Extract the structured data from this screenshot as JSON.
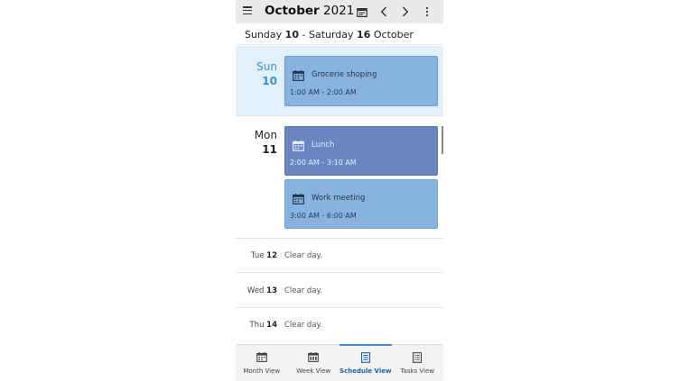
{
  "header": {
    "month": "October",
    "year": "2021"
  },
  "range": {
    "start_day": "Sunday",
    "start_num": "10",
    "separator": "-",
    "end_day": "Saturday",
    "end_num": "16",
    "end_month": "October"
  },
  "days": [
    {
      "name": "Sun",
      "num": "10",
      "events": [
        {
          "title": "Grocerie shoping",
          "time": "1:00 AM - 2:00 AM"
        }
      ]
    },
    {
      "name": "Mon",
      "num": "11",
      "events": [
        {
          "title": "Lunch",
          "time": "2:00 AM - 3:10 AM"
        },
        {
          "title": "Work meeting",
          "time": "3:00 AM - 6:00 AM"
        }
      ]
    }
  ],
  "clear_days": [
    {
      "name": "Tue",
      "num": "12",
      "text": "Clear day."
    },
    {
      "name": "Wed",
      "num": "13",
      "text": "Clear day."
    },
    {
      "name": "Thu",
      "num": "14",
      "text": "Clear day."
    }
  ],
  "nav": [
    {
      "label": "Month View",
      "icon": "calendar-month-icon"
    },
    {
      "label": "Week View",
      "icon": "calendar-week-icon"
    },
    {
      "label": "Schedule View",
      "icon": "schedule-list-icon",
      "active": true
    },
    {
      "label": "Tasks View",
      "icon": "tasks-list-icon"
    }
  ],
  "colors": {
    "accent": "#3d8fd8",
    "today_bg": "#e3f0fa",
    "event_light": "#88b3e0",
    "event_dark": "#6a86c2"
  }
}
